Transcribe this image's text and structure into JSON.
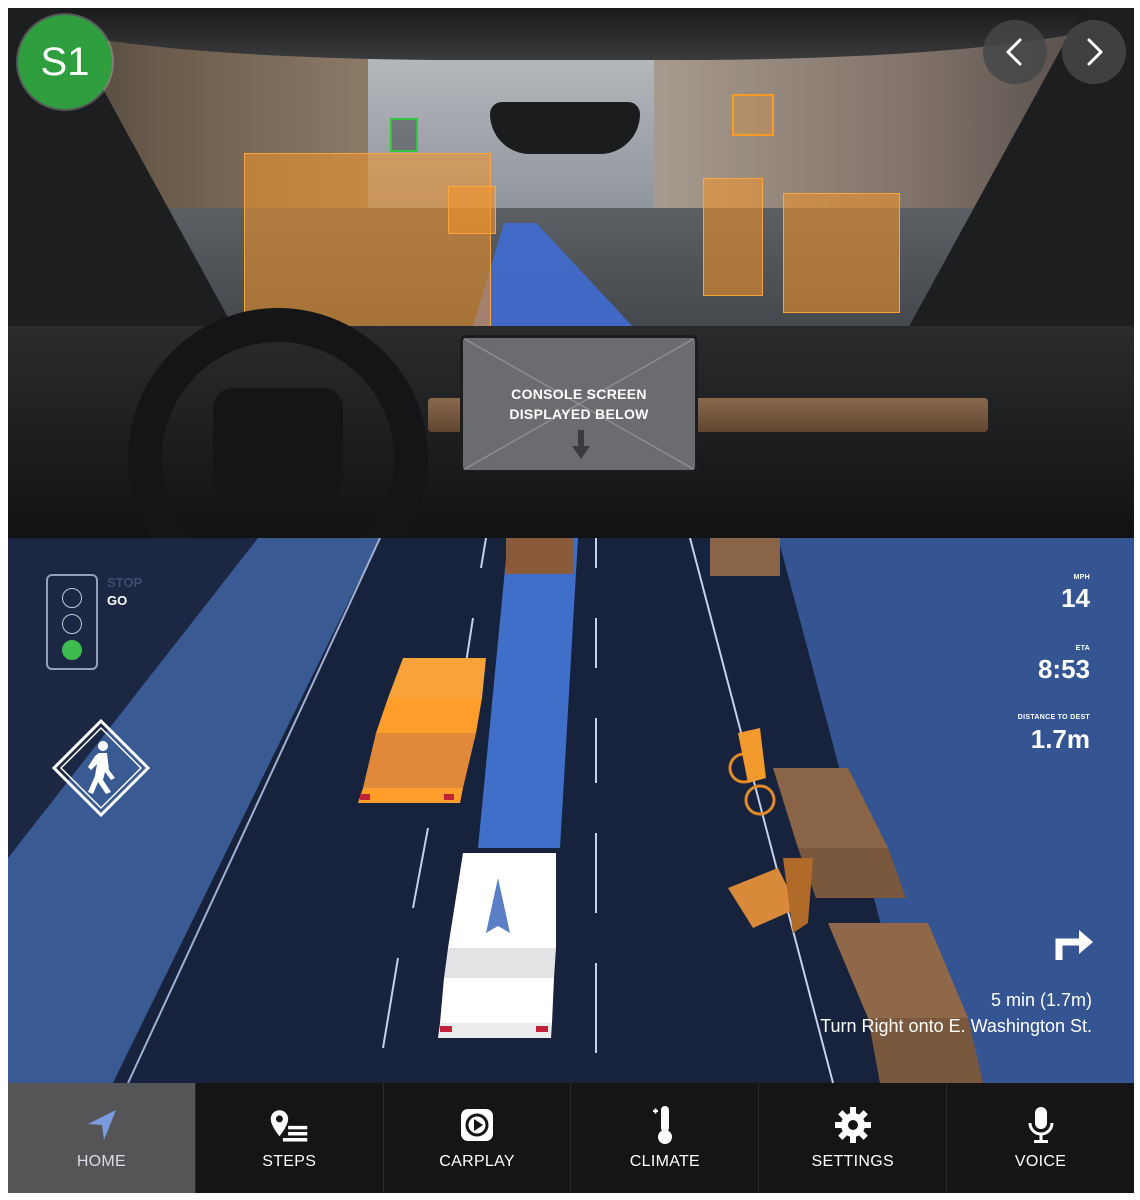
{
  "badge": {
    "label": "S1",
    "color": "#2e9e3e"
  },
  "navigation_buttons": {
    "prev_icon": "chevron-left-icon",
    "next_icon": "chevron-right-icon"
  },
  "camera_view": {
    "console_placeholder": {
      "line1": "CONSOLE SCREEN",
      "line2": "DISPLAYED BELOW",
      "icon": "arrow-down-icon"
    },
    "detection_color": "#f5962a"
  },
  "nav_view": {
    "traffic_light": {
      "stop_label": "STOP",
      "go_label": "GO",
      "active_state": "go",
      "active_color": "#3dbb4f"
    },
    "pedestrian_sign_icon": "pedestrian-crossing-icon",
    "stats": {
      "mph_label": "MPH",
      "mph_value": "14",
      "eta_label": "ETA",
      "eta_value": "8:53",
      "distance_label": "DISTANCE TO DEST",
      "distance_value": "1.7m"
    },
    "route": {
      "turn_icon": "turn-right-icon",
      "time_text": "5 min (1.7m)",
      "instruction": "Turn Right onto E. Washington St."
    },
    "colors": {
      "road": "#1b2743",
      "lane_highlight": "#3f6fc8",
      "car": "#f59a2c",
      "ego_vehicle": "#ffffff"
    }
  },
  "toolbar": {
    "items": [
      {
        "label": "HOME",
        "icon": "navigation-arrow-icon",
        "active": true
      },
      {
        "label": "STEPS",
        "icon": "map-pin-list-icon",
        "active": false
      },
      {
        "label": "CARPLAY",
        "icon": "carplay-icon",
        "active": false
      },
      {
        "label": "CLIMATE",
        "icon": "thermometer-icon",
        "active": false
      },
      {
        "label": "SETTINGS",
        "icon": "gear-icon",
        "active": false
      },
      {
        "label": "VOICE",
        "icon": "microphone-icon",
        "active": false
      }
    ]
  }
}
